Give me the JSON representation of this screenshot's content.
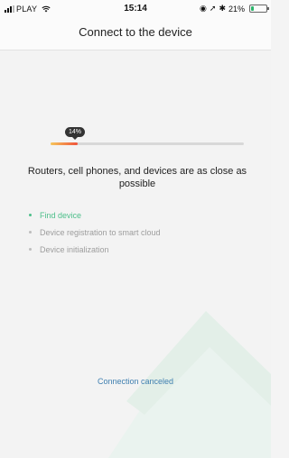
{
  "status_bar": {
    "carrier": "PLAY",
    "time": "15:14",
    "battery_percent": "21%",
    "battery_level": 0.21
  },
  "header": {
    "title": "Connect to the device"
  },
  "progress": {
    "label": "14%",
    "value": 0.14
  },
  "message": "Routers, cell phones, and devices are as close as possible",
  "steps": [
    {
      "label": "Find device",
      "state": "active"
    },
    {
      "label": "Device registration to smart cloud",
      "state": "pending"
    },
    {
      "label": "Device initialization",
      "state": "pending"
    }
  ],
  "footer": {
    "cancel_label": "Connection canceled"
  },
  "colors": {
    "accent": "#4cbf8a",
    "progress_start": "#f6c65b",
    "progress_end": "#f0533b",
    "link": "#3f7fb0"
  }
}
